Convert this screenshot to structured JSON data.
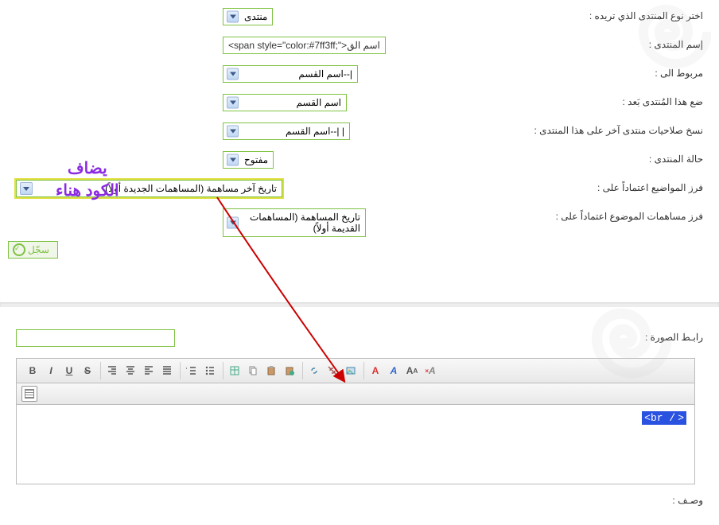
{
  "labels": {
    "forum_type": "اختر نوع المنتدى الذي تريده :",
    "forum_name": "إسم المنتدى :",
    "linked_to": "مربوط الى :",
    "place_after": "ضع هذا المُنتدى بَعد :",
    "copy_perms": "نسخ صلاحيات منتدى آخر على هذا المنتدى :",
    "forum_state": "حالة المنتدى :",
    "sort_topics": "فرز المواضيع اعتماداً على :",
    "sort_posts": "فرز مساهمات الموضوع اعتماداً على :",
    "image_link": "رابـط الصورة :",
    "description": "وصـف :"
  },
  "fields": {
    "forum_type_value": "منتدى",
    "forum_name_value": "<span style=\"color:#7ff3ff;\">اسم الق",
    "linked_to_value": "|--اسم القسم",
    "place_after_value": "اسم القسم",
    "copy_perms_value": "|   |--اسم القسم",
    "forum_state_value": "مفتوح",
    "sort_topics_value": "تاريخ آخر مساهمة (المساهمات الجديدة أولاً)",
    "sort_posts_value": "تاريخ المساهمة (المساهمات القديمة أولاً)"
  },
  "annotation": {
    "line1": "يضاف",
    "line2": "الكود هناء"
  },
  "buttons": {
    "save": "سجّل"
  },
  "editor": {
    "code_snippet": "<br /"
  },
  "toolbar_titles": {
    "bold": "Bold",
    "italic": "Italic",
    "underline": "Underline",
    "strike": "Strikethrough",
    "align_right": "Align Right",
    "align_center": "Align Center",
    "align_left": "Align Left",
    "justify": "Justify",
    "ol": "Ordered List",
    "ul": "Unordered List",
    "table": "Table",
    "copy": "Copy",
    "paste": "Paste",
    "paste_special": "Paste Special",
    "link": "Link",
    "unlink": "Unlink",
    "image": "Image",
    "font_color": "Font Color",
    "font": "Font",
    "font_size": "Font Size",
    "remove_format": "Remove Format",
    "source": "Source"
  }
}
